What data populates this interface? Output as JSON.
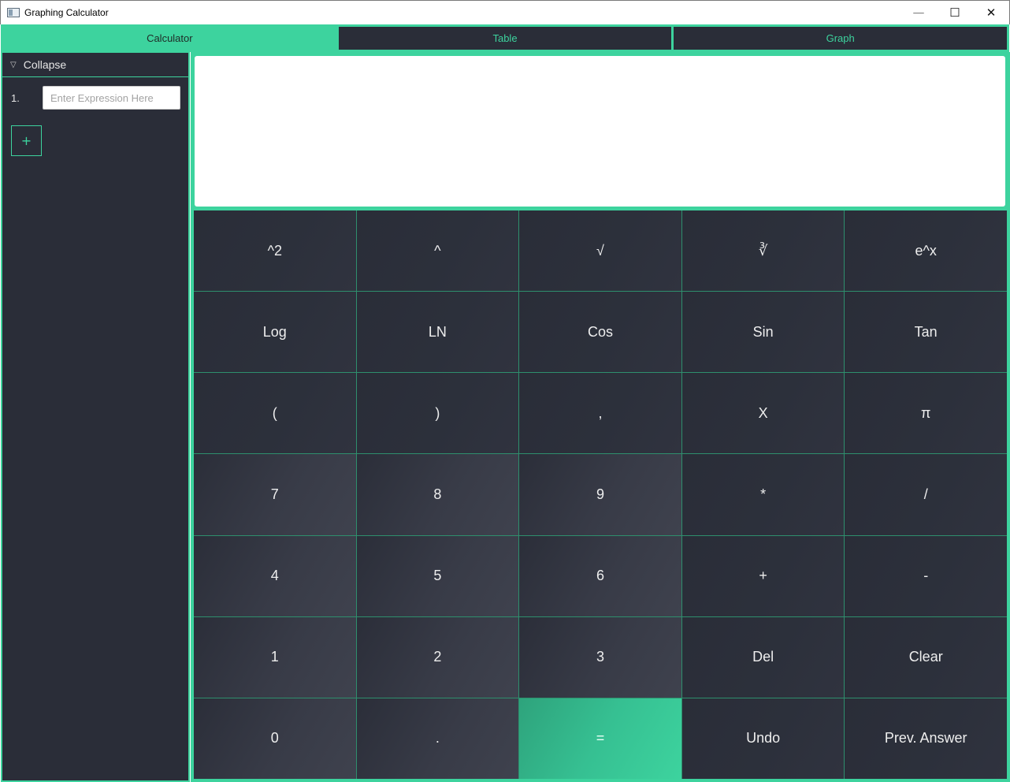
{
  "window": {
    "title": "Graphing Calculator",
    "minimize_glyph": "—",
    "maximize_glyph": "☐",
    "close_glyph": "✕"
  },
  "tabs": [
    {
      "label": "Calculator",
      "active": true
    },
    {
      "label": "Table",
      "active": false
    },
    {
      "label": "Graph",
      "active": false
    }
  ],
  "sidebar": {
    "collapse_label": "Collapse",
    "collapse_icon": "chevron-down-icon",
    "expressions": [
      {
        "index": "1.",
        "value": "",
        "placeholder": "Enter Expression Here"
      }
    ],
    "add_label": "+"
  },
  "display": {
    "value": ""
  },
  "keypad": {
    "rows": [
      [
        "^2",
        "^",
        "√",
        "∛",
        "e^x"
      ],
      [
        "Log",
        "LN",
        "Cos",
        "Sin",
        "Tan"
      ],
      [
        "(",
        ")",
        ",",
        "X",
        "π"
      ],
      [
        "7",
        "8",
        "9",
        "*",
        "/"
      ],
      [
        "4",
        "5",
        "6",
        "+",
        "-"
      ],
      [
        "1",
        "2",
        "3",
        "Del",
        "Clear"
      ],
      [
        "0",
        ".",
        "=",
        "Undo",
        "Prev. Answer"
      ]
    ]
  },
  "colors": {
    "accent": "#3dd39e",
    "panel": "#2a2d38",
    "text": "#eeeeee"
  }
}
